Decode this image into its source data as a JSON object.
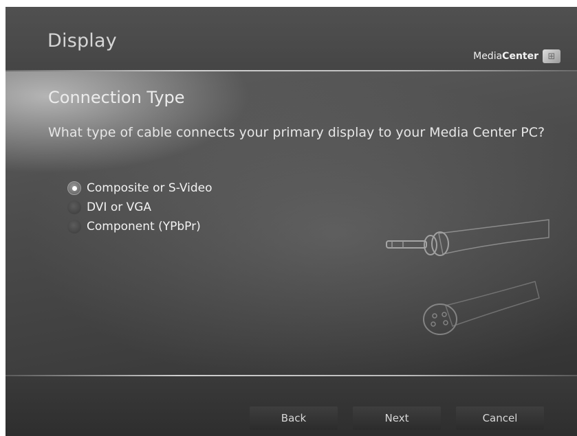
{
  "header": {
    "title": "Display",
    "brand_prefix": "Media",
    "brand_bold": "Center",
    "logo_icon": "windows-flag-icon"
  },
  "main": {
    "section_title": "Connection Type",
    "question": "What type of cable connects your primary display to your Media Center PC?",
    "options": [
      {
        "label": "Composite or S-Video",
        "selected": true
      },
      {
        "label": "DVI or VGA",
        "selected": false
      },
      {
        "label": "Component (YPbPr)",
        "selected": false
      }
    ],
    "illustration": "cable-connectors-illustration"
  },
  "footer": {
    "back_label": "Back",
    "next_label": "Next",
    "cancel_label": "Cancel"
  }
}
